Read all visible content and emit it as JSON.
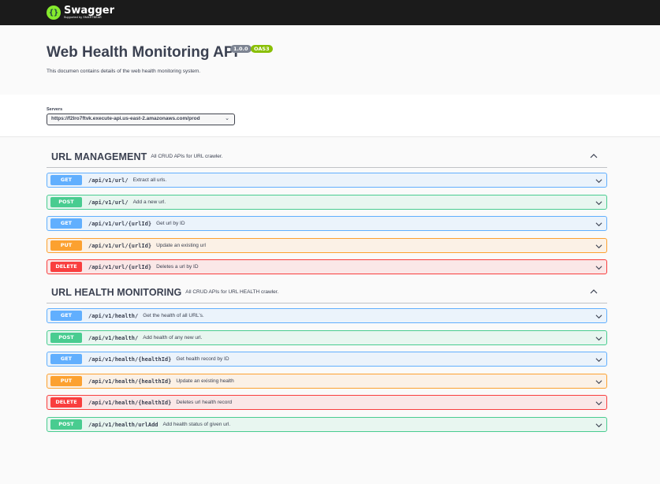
{
  "topbar": {
    "logo_name": "Swagger",
    "logo_sub": "Supported by SMARTBEAR",
    "logo_glyph": "{}"
  },
  "info": {
    "title": "Web Health Monitoring API",
    "version_badge": "1.0.0",
    "oas_badge": "OAS3",
    "description": "This documen contains details of the web health monitoring system."
  },
  "servers": {
    "label": "Servers",
    "selected": "https://f2lro7ftvk.execute-api.us-east-2.amazonaws.com/prod"
  },
  "tags": [
    {
      "name": "URL MANAGEMENT",
      "description": "All CRUD APIs for URL crawler.",
      "operations": [
        {
          "method": "GET",
          "path": "/api/v1/url/",
          "summary": "Extract all urls."
        },
        {
          "method": "POST",
          "path": "/api/v1/url/",
          "summary": "Add a new url."
        },
        {
          "method": "GET",
          "path": "/api/v1/url/{urlId}",
          "summary": "Get url by ID"
        },
        {
          "method": "PUT",
          "path": "/api/v1/url/{urlId}",
          "summary": "Update an existing url"
        },
        {
          "method": "DELETE",
          "path": "/api/v1/url/{urlId}",
          "summary": "Deletes a url by ID"
        }
      ]
    },
    {
      "name": "URL HEALTH MONITORING",
      "description": "All CRUD APIs for URL HEALTH crawler.",
      "operations": [
        {
          "method": "GET",
          "path": "/api/v1/health/",
          "summary": "Get the health of all URL's."
        },
        {
          "method": "POST",
          "path": "/api/v1/health/",
          "summary": "Add health of any new url."
        },
        {
          "method": "GET",
          "path": "/api/v1/health/{healthId}",
          "summary": "Get health record by ID"
        },
        {
          "method": "PUT",
          "path": "/api/v1/health/{healthId}",
          "summary": "Update an existing health"
        },
        {
          "method": "DELETE",
          "path": "/api/v1/health/{healthId}",
          "summary": "Deletes url health record"
        },
        {
          "method": "POST",
          "path": "/api/v1/health/urlAdd",
          "summary": "Add health status of given url."
        }
      ]
    }
  ],
  "colors": {
    "GET": "#61affe",
    "POST": "#49cc90",
    "PUT": "#fca130",
    "DELETE": "#f93e3e"
  }
}
